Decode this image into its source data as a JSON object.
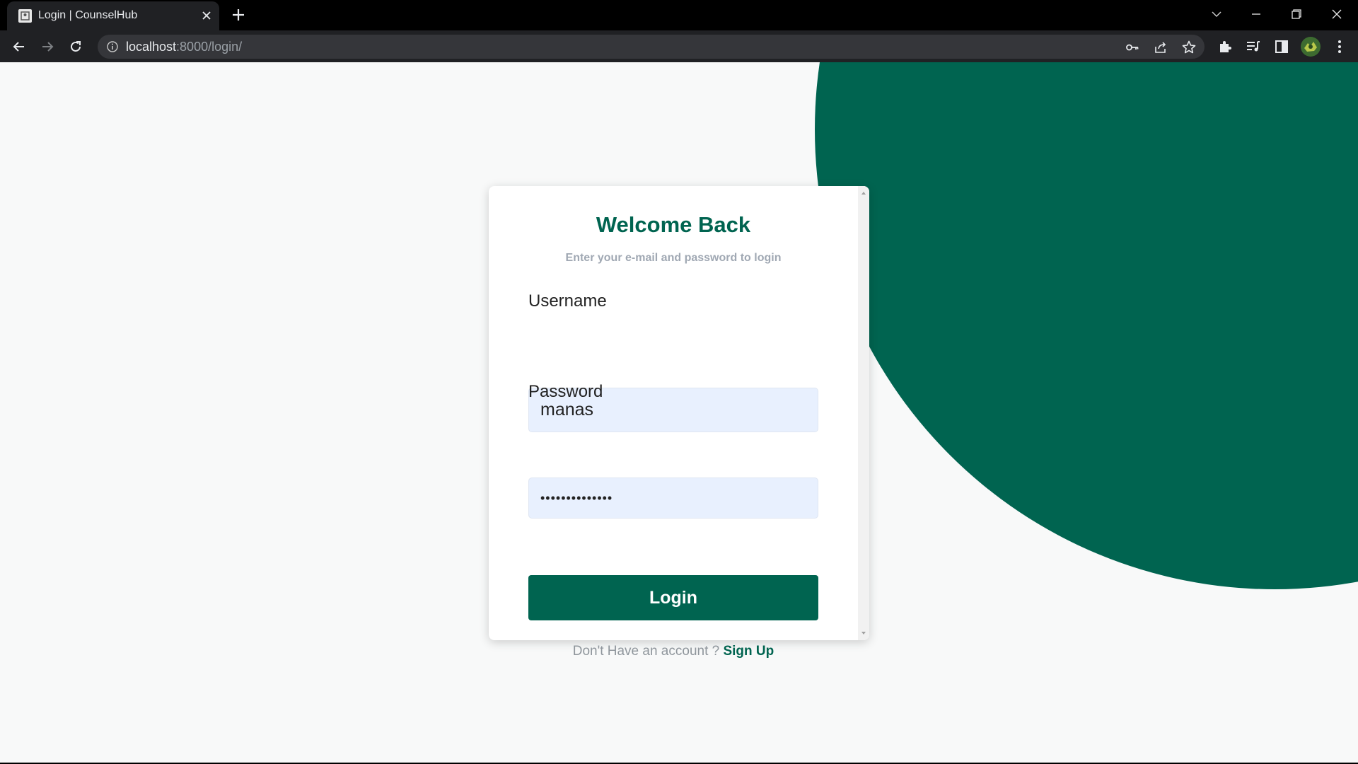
{
  "browser": {
    "tab_title": "Login | CounselHub",
    "url_host": "localhost",
    "url_rest": ":8000/login/"
  },
  "login": {
    "heading": "Welcome Back",
    "subtitle": "Enter your e-mail and password to login",
    "username_label": "Username",
    "username_value": "manas",
    "password_label": "Password",
    "password_value": "manas@12345678",
    "login_button": "Login",
    "signup_prompt": "Don't Have an account ?",
    "signup_link": "Sign Up"
  },
  "colors": {
    "brand": "#006450",
    "page_bg": "#f8f9f9",
    "input_bg": "#e8f0fe"
  }
}
